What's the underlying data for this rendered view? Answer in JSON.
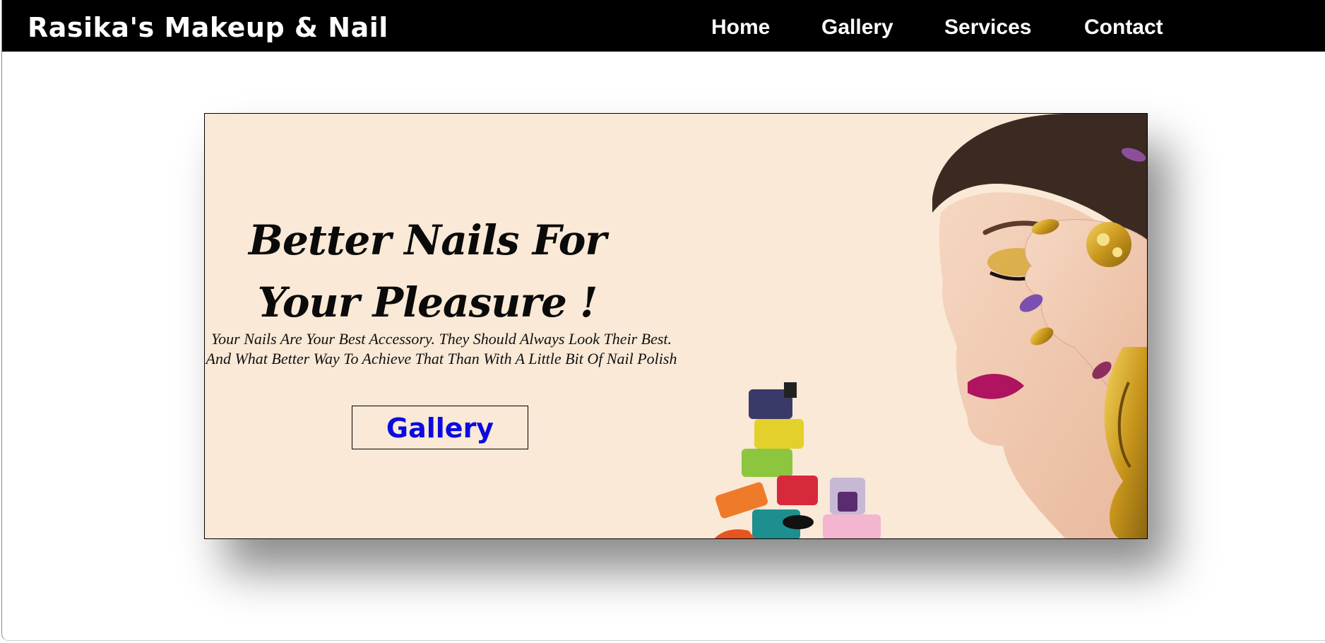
{
  "site": {
    "brand": "Rasika's Makeup & Nail"
  },
  "nav": {
    "items": [
      "Home",
      "Gallery",
      "Services",
      "Contact"
    ]
  },
  "hero": {
    "headline": "Better Nails For Your Pleasure !",
    "tagline": "Your Nails Are Your Best Accessory. They Should Always Look Their Best. And What Better Way To Achieve That Than With A Little Bit Of Nail Polish",
    "button_label": "Gallery",
    "image_subject": "woman-with-painted-nails-and-polish-bottles"
  },
  "colors": {
    "navbar": "#000000",
    "nav_text": "#ffffff",
    "hero_bg": "#f9e9d6",
    "button_text": "#0b0be0"
  }
}
